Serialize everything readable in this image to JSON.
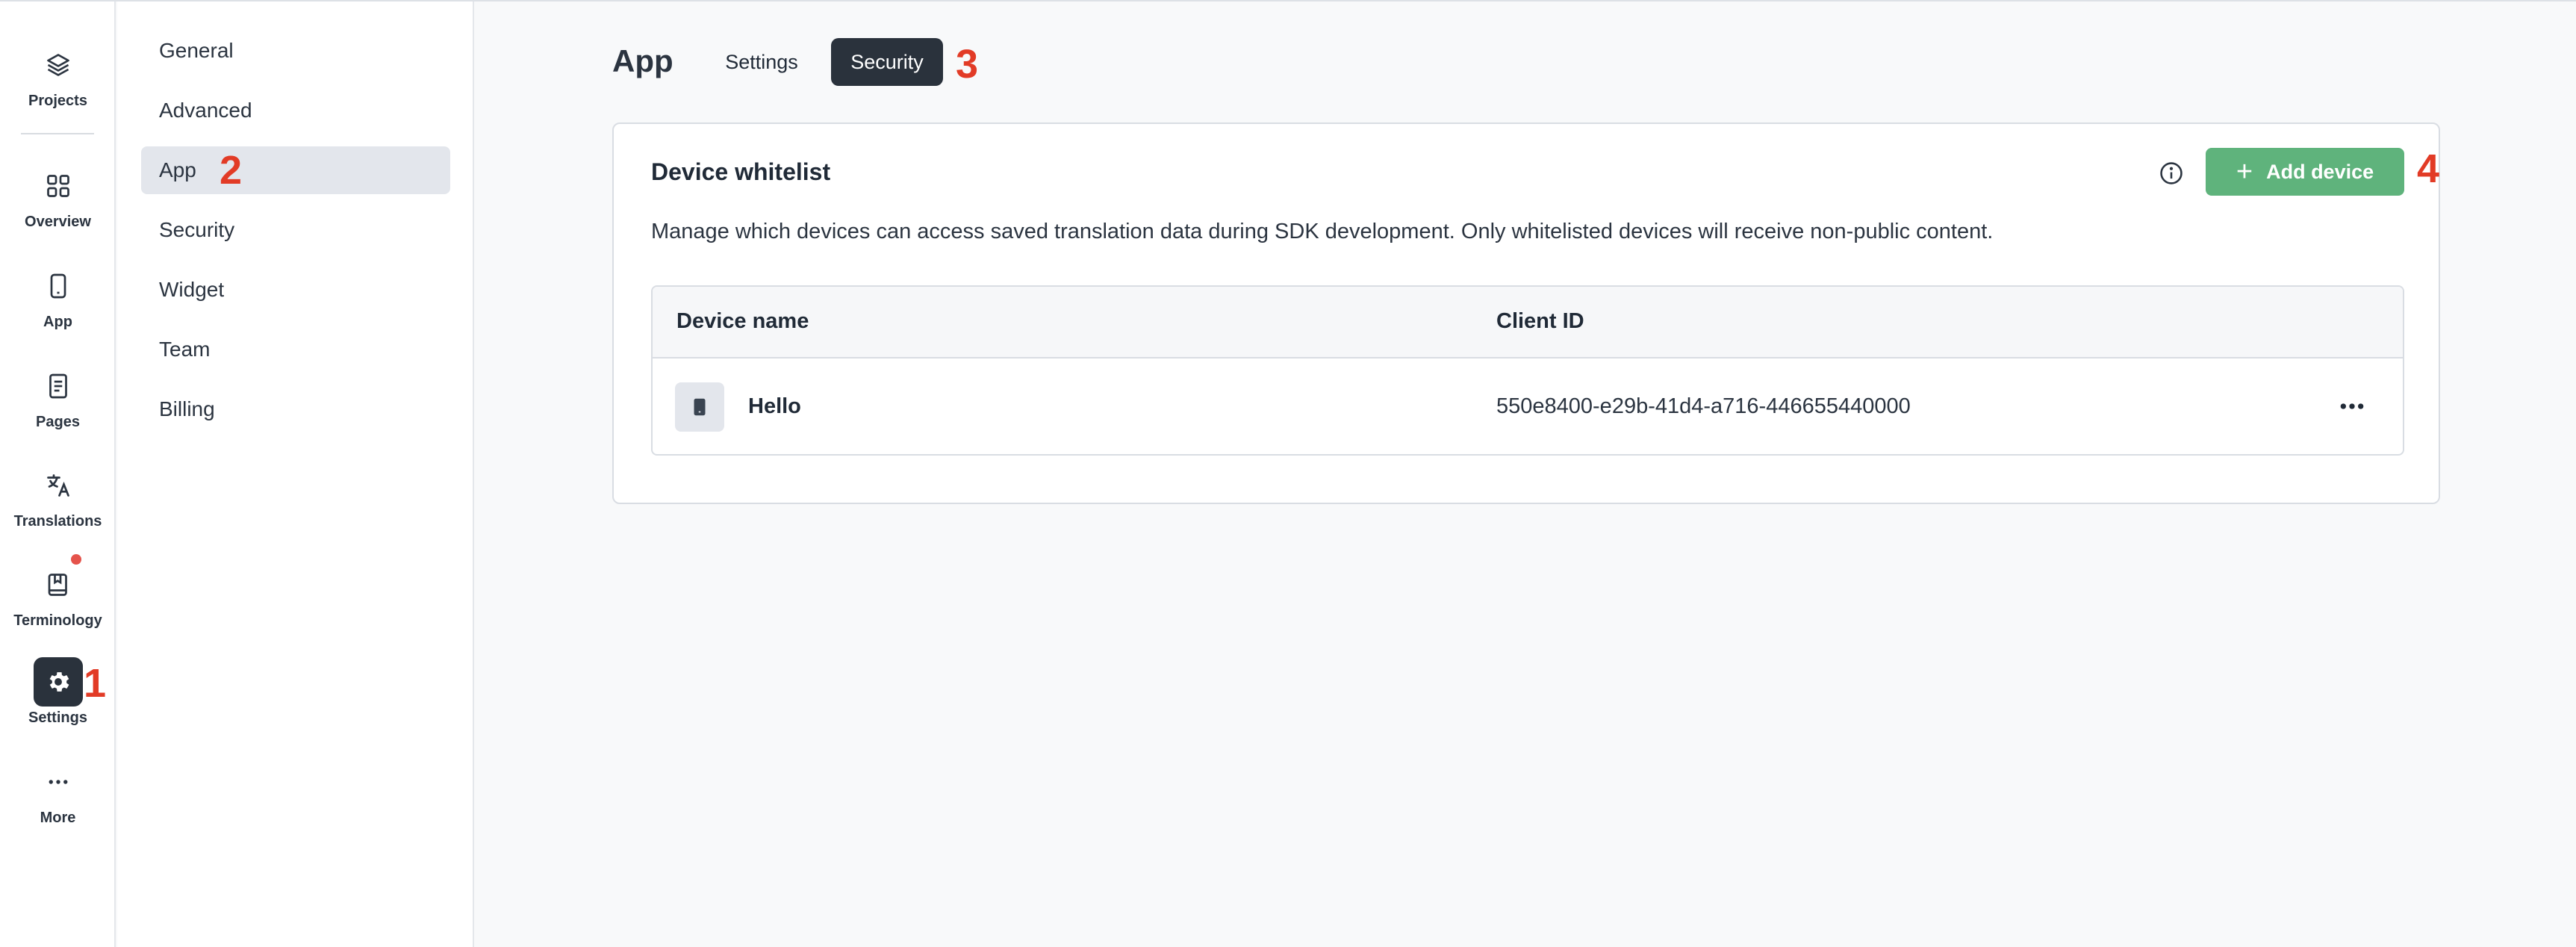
{
  "rail": {
    "items": [
      {
        "label": "Projects",
        "icon": "layers-icon"
      },
      {
        "label": "Overview",
        "icon": "grid-icon"
      },
      {
        "label": "App",
        "icon": "phone-icon"
      },
      {
        "label": "Pages",
        "icon": "document-icon"
      },
      {
        "label": "Translations",
        "icon": "translate-icon"
      },
      {
        "label": "Terminology",
        "icon": "book-icon"
      },
      {
        "label": "Settings",
        "icon": "gear-icon",
        "active": true
      },
      {
        "label": "More",
        "icon": "more-icon"
      }
    ]
  },
  "subnav": {
    "items": [
      {
        "label": "General"
      },
      {
        "label": "Advanced"
      },
      {
        "label": "App",
        "active": true
      },
      {
        "label": "Security"
      },
      {
        "label": "Widget"
      },
      {
        "label": "Team"
      },
      {
        "label": "Billing"
      }
    ]
  },
  "header": {
    "title": "App",
    "tabs": [
      {
        "label": "Settings"
      },
      {
        "label": "Security",
        "active": true
      }
    ]
  },
  "card": {
    "title": "Device whitelist",
    "description": "Manage which devices can access saved translation data during SDK development. Only whitelisted devices will receive non-public content.",
    "add_button_label": "Add device",
    "table": {
      "columns": [
        "Device name",
        "Client ID"
      ],
      "rows": [
        {
          "name": "Hello",
          "client_id": "550e8400-e29b-41d4-a716-446655440000"
        }
      ]
    }
  },
  "annotations": [
    "1",
    "2",
    "3",
    "4"
  ],
  "colors": {
    "accent_dark": "#2a323c",
    "add_button": "#5fb37c",
    "annotation": "#e23b26",
    "notification": "#e5534b"
  }
}
